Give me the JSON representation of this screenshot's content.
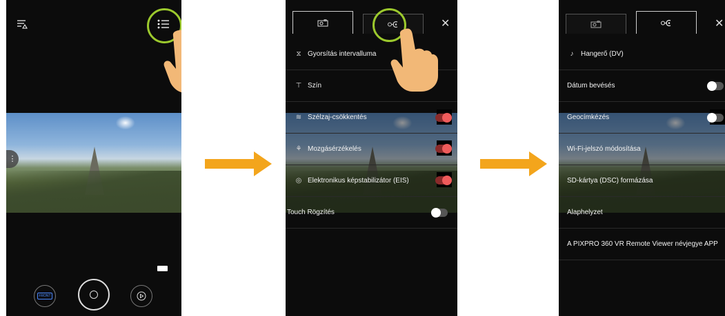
{
  "screen1": {
    "front_label": "FRONT"
  },
  "screen2": {
    "items": [
      {
        "label": "Gyorsítás intervalluma"
      },
      {
        "label": "Szín"
      },
      {
        "label": "Szélzaj-csökkentés"
      },
      {
        "label": "Mozgásérzékelés"
      },
      {
        "label": "Elektronikus képstabilizátor (EIS)"
      },
      {
        "label": "Touch Rögzítés"
      }
    ],
    "close_symbol": "✕"
  },
  "screen3": {
    "items": [
      {
        "label": "Hangerő (DV)"
      },
      {
        "label": "Dátum bevésés"
      },
      {
        "label": "Geocímkézés"
      },
      {
        "label": "Wi-Fi-jelszó módosítása"
      },
      {
        "label": "SD-kártya (DSC) formázása"
      },
      {
        "label": "Alaphelyzet"
      },
      {
        "label": "A PIXPRO 360 VR Remote Viewer névjegye APP"
      }
    ],
    "close_symbol": "✕"
  },
  "colors": {
    "highlight": "#9cc92d",
    "arrow": "#f3a51c",
    "toggle_on": "#ef5b5b",
    "hand": "#f2b877"
  }
}
